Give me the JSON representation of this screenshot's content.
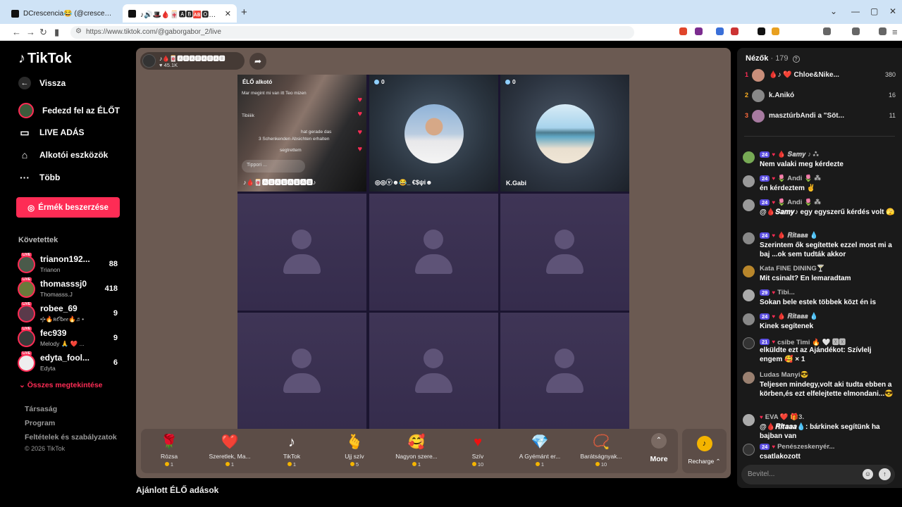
{
  "browser": {
    "tabs": [
      {
        "title": "DCrescencia😂 (@crescencia27) ÉLŐ"
      },
      {
        "title": "♪🔊🎩🩸🀄🅰🅱🆎🅾🅱🅰🅱"
      }
    ],
    "url": "https://www.tiktok.com/@gaborgabor_2/live"
  },
  "sidebar": {
    "logo": "TikTok",
    "back": "Vissza",
    "nav": [
      {
        "label": "Fedezd fel az ÉLŐT",
        "icon": "avatar-icon"
      },
      {
        "label": "LIVE ADÁS",
        "icon": "camera-icon"
      },
      {
        "label": "Alkotói eszközök",
        "icon": "home-icon"
      },
      {
        "label": "Több",
        "icon": "more-dots-icon"
      }
    ],
    "coins_button": "Érmék beszerzése",
    "following_title": "Követettek",
    "following": [
      {
        "name": "trianon192...",
        "sub": "Trianon",
        "count": "88"
      },
      {
        "name": "thomasssj0",
        "sub": "Thomasss.J",
        "count": "418"
      },
      {
        "name": "robee_69",
        "sub": "•ʃ•🔥ʀ𝒪ɓ𝑒𝑒🔥♬•",
        "count": "9"
      },
      {
        "name": "fec939",
        "sub": "Melody 🙏 ❤️ ...",
        "count": "9"
      },
      {
        "name": "edyta_fool...",
        "sub": "Edyta",
        "count": "6"
      }
    ],
    "see_all": "Összes megtekintése",
    "footer": [
      "Társaság",
      "Program",
      "Feltételek és szabályzatok"
    ],
    "copyright": "© 2026 TikTok",
    "live_badge": "LIVE"
  },
  "stream": {
    "host_name": "♪🩸🀄🅰🅱🅰🅱🅰🅱🅰🅱",
    "host_likes": "45.1K",
    "cell1": {
      "label": "ÉLŐ alkotó",
      "chat": [
        "Mar megint mi van itt Teo mizen",
        "Tibiiiik",
        "hat gerade das",
        "3 Schenkenden Absichten erhalten",
        "segtrettem"
      ],
      "input": "Tippori ...",
      "bottom": "♪🩸🀄🅰🅱🅰🅱🅰🅱🅰🅱♪"
    },
    "cell2": {
      "score": "0",
      "name": "◎◎ⓥ☻😂_ €$ψi☻"
    },
    "cell3": {
      "score": "0",
      "name": "K.Gabi"
    },
    "gifts": [
      {
        "name": "Rózsa",
        "price": "1",
        "icon": "rose-icon"
      },
      {
        "name": "Szeretlek, Ma...",
        "price": "1",
        "icon": "heart-map-icon"
      },
      {
        "name": "TikTok",
        "price": "1",
        "icon": "tiktok-icon"
      },
      {
        "name": "Ujj szív",
        "price": "5",
        "icon": "finger-heart-icon"
      },
      {
        "name": "Nagyon szere...",
        "price": "1",
        "icon": "love-face-icon"
      },
      {
        "name": "Szív",
        "price": "10",
        "icon": "heart-icon"
      },
      {
        "name": "A Gyémánt er...",
        "price": "1",
        "icon": "diamond-icon"
      },
      {
        "name": "Barátságnyak...",
        "price": "10",
        "icon": "friendship-necklace-icon"
      }
    ],
    "more_label": "More",
    "recharge_label": "Recharge ⌃"
  },
  "below_title": "Ajánlott ÉLŐ adások",
  "chat": {
    "viewers_label": "Nézők",
    "viewers_count": "· 179",
    "ranking": [
      {
        "rank": "1",
        "name": "🩸♪ ❤️ Chloe&Nike...",
        "score": "380"
      },
      {
        "rank": "2",
        "name": "k.Anikó",
        "score": "16"
      },
      {
        "rank": "3",
        "name": "masztúrbAndi a \"Söt...",
        "score": "11"
      }
    ],
    "messages": [
      {
        "level": "24",
        "user": "🩸 𝑺𝒂𝒎𝒚 ♪ ⁂",
        "text": "Nem valaki meg kérdezte"
      },
      {
        "level": "24",
        "user": "🌷 Andi 🌷 ⁂",
        "text": "én kérdeztem ✌"
      },
      {
        "level": "24",
        "user": "🌷 Andi 🌷 ⁂",
        "text": "@🩸𝑺𝒂𝒎𝒚♪ egy egyszerű kérdés volt 🫣"
      },
      {
        "level": "24",
        "user": "🩸 𝑹𝒊𝒕𝒂𝒂𝒂 💧",
        "text": "Szerintem ők segítettek ezzel most mi a baj ...ok sem tudták akkor"
      },
      {
        "level": "",
        "user": "Kata FINE DINING🍸",
        "text": "Mit csinalt? En lemaradtam"
      },
      {
        "level": "29",
        "user": "Tibi...",
        "text": "Sokan bele estek többek közt én is"
      },
      {
        "level": "24",
        "user": "🩸 𝑹𝒊𝒕𝒂𝒂𝒂 💧",
        "text": "Kinek segítenek"
      },
      {
        "level": "21",
        "user": "csibe Timi 🔥 🤍 🆇🆇",
        "text": "elküldte ezt az Ajándékot: Szívlelj engem 🥰 × 1"
      },
      {
        "level": "",
        "user": "Ludas Manyi😎",
        "text": "Teljesen mindegy,volt aki tudta ebben a körben,és ezt elfelejtette elmondani...😎"
      },
      {
        "level": "",
        "user": "EVA ❤️ 🎁3.",
        "text": "@🩸𝑹𝒊𝒕𝒂𝒂𝒂💧: bárkinek segítünk ha bajban van"
      },
      {
        "level": "24",
        "user": "Penészeskenyér...",
        "text": "csatlakozott"
      }
    ],
    "input_placeholder": "Bevitel..."
  }
}
